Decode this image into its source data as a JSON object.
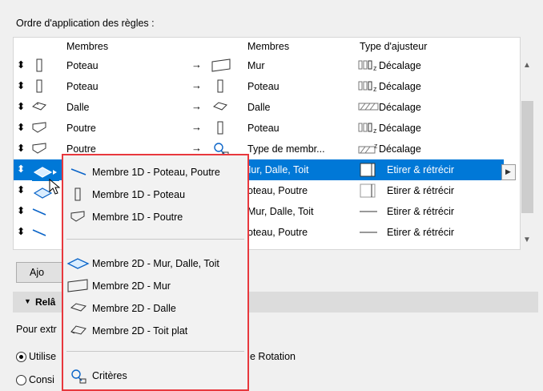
{
  "section_title": "Ordre d'application des règles :",
  "table": {
    "headers": {
      "members_left": "Membres",
      "members_right": "Membres",
      "adjuster_type": "Type d'ajusteur"
    },
    "rows": [
      {
        "left": "Poteau",
        "right": "Mur",
        "adjuster": "Décalage"
      },
      {
        "left": "Poteau",
        "right": "Poteau",
        "adjuster": "Décalage"
      },
      {
        "left": "Dalle",
        "right": "Dalle",
        "adjuster": "Décalage"
      },
      {
        "left": "Poutre",
        "right": "Poteau",
        "adjuster": "Décalage"
      },
      {
        "left": "Poutre",
        "right": "Type de membr...",
        "adjuster": "Décalage"
      },
      {
        "left": "",
        "right": "Mur, Dalle, Toit",
        "adjuster": "Etirer & rétrécir"
      },
      {
        "left": "",
        "right": "oteau, Poutre",
        "adjuster": "Etirer & rétrécir"
      },
      {
        "left": "",
        "right": "Mur, Dalle, Toit",
        "adjuster": "Etirer & rétrécir"
      },
      {
        "left": "",
        "right": "oteau, Poutre",
        "adjuster": "Etirer & rétrécir"
      }
    ],
    "arrow": "→",
    "drag_handle": "⬍",
    "adjuster_icon_z": "z"
  },
  "add_button": "Ajo",
  "collapse_section": "Relâ",
  "pour_text": "Pour extr",
  "radio1": "Utilise",
  "radio1_tail": "e Rotation",
  "radio2": "Consi",
  "menu": {
    "items": [
      "Membre 1D - Poteau, Poutre",
      "Membre 1D - Poteau",
      "Membre 1D - Poutre",
      "Membre 2D - Mur, Dalle, Toit",
      "Membre 2D - Mur",
      "Membre 2D - Dalle",
      "Membre 2D - Toit plat",
      "Critères"
    ]
  },
  "dropdown_arrow": "▶",
  "scroll_up": "▲",
  "scroll_down": "▼",
  "colors": {
    "selection": "#0078d7",
    "popup_border": "#e8383d"
  }
}
